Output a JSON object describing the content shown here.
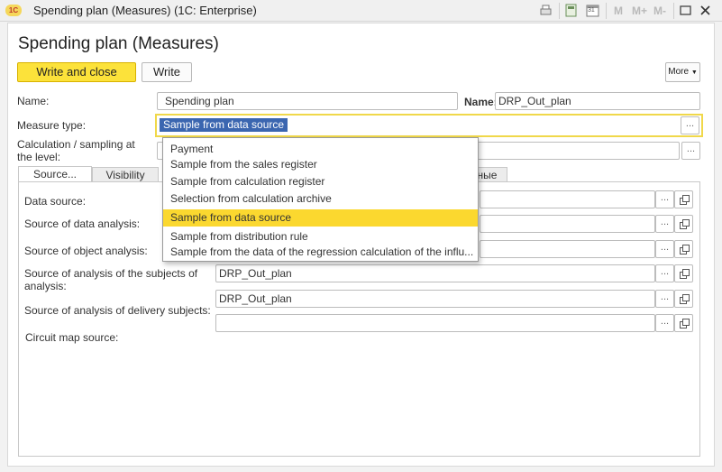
{
  "window": {
    "app_icon_text": "1C",
    "title": "Spending plan (Measures) (1C: Enterprise)"
  },
  "toolbar_icons": [
    "print-icon",
    "calculator-icon",
    "calendar-icon",
    "memory-m-icon",
    "memory-plus-icon",
    "memory-minus-icon",
    "maximize-icon",
    "close-icon"
  ],
  "memory": {
    "m": "M",
    "m_plus": "M+",
    "m_minus": "M-"
  },
  "calendar_number": "31",
  "form": {
    "title": "Spending plan (Measures)",
    "write_close": "Write and close",
    "write": "Write",
    "more": "More"
  },
  "fields": {
    "name_label": "Name:",
    "name_value": "Spending plan",
    "name2_label": "Name:",
    "name2_value": "DRP_Out_plan",
    "measure_type_label": "Measure type:",
    "measure_type_value": "Sample from data source",
    "calc_level_label": "Calculation / sampling at the level:",
    "ellipsis": "..."
  },
  "tabs": [
    "Source...",
    "Visibility",
    "ные"
  ],
  "source_tab": {
    "data_source_label": "Data source:",
    "analysis_source_label": "Source of data analysis:",
    "object_source_label": "Source of object analysis:",
    "subjects_source_label": "Source of analysis of the subjects of analysis:",
    "subjects_source_value": "DRP_Out_plan",
    "delivery_source_label": "Source of analysis of delivery subjects:",
    "delivery_source_value": "DRP_Out_plan",
    "circuit_map_label": "Circuit map source:"
  },
  "dropdown": {
    "items": [
      "Payment",
      "Sample from the sales register",
      "Sample from calculation register",
      "Selection from calculation archive",
      "Sample from data source",
      "Sample from distribution rule",
      "Sample from the data of the regression calculation of the influ..."
    ],
    "selected_index": 4
  }
}
